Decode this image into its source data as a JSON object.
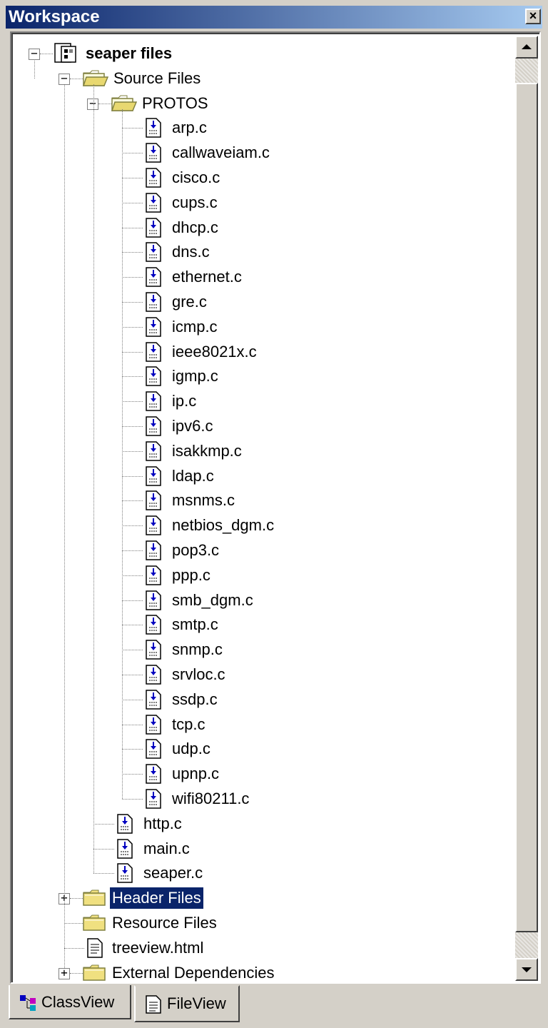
{
  "window": {
    "title": "Workspace"
  },
  "tree": {
    "root": "seaper files",
    "source_files": "Source Files",
    "protos": "PROTOS",
    "proto_files": [
      "arp.c",
      "callwaveiam.c",
      "cisco.c",
      "cups.c",
      "dhcp.c",
      "dns.c",
      "ethernet.c",
      "gre.c",
      "icmp.c",
      "ieee8021x.c",
      "igmp.c",
      "ip.c",
      "ipv6.c",
      "isakkmp.c",
      "ldap.c",
      "msnms.c",
      "netbios_dgm.c",
      "pop3.c",
      "ppp.c",
      "smb_dgm.c",
      "smtp.c",
      "snmp.c",
      "srvloc.c",
      "ssdp.c",
      "tcp.c",
      "udp.c",
      "upnp.c",
      "wifi80211.c"
    ],
    "source_extra": [
      "http.c",
      "main.c",
      "seaper.c"
    ],
    "header_files": "Header Files",
    "resource_files": "Resource Files",
    "treeview_file": "treeview.html",
    "external_deps": "External Dependencies"
  },
  "tabs": {
    "classview": "ClassView",
    "fileview": "FileView"
  },
  "colors": {
    "selection": "#0a246a",
    "titlebar_start": "#0a246a",
    "titlebar_end": "#a6caf0"
  }
}
